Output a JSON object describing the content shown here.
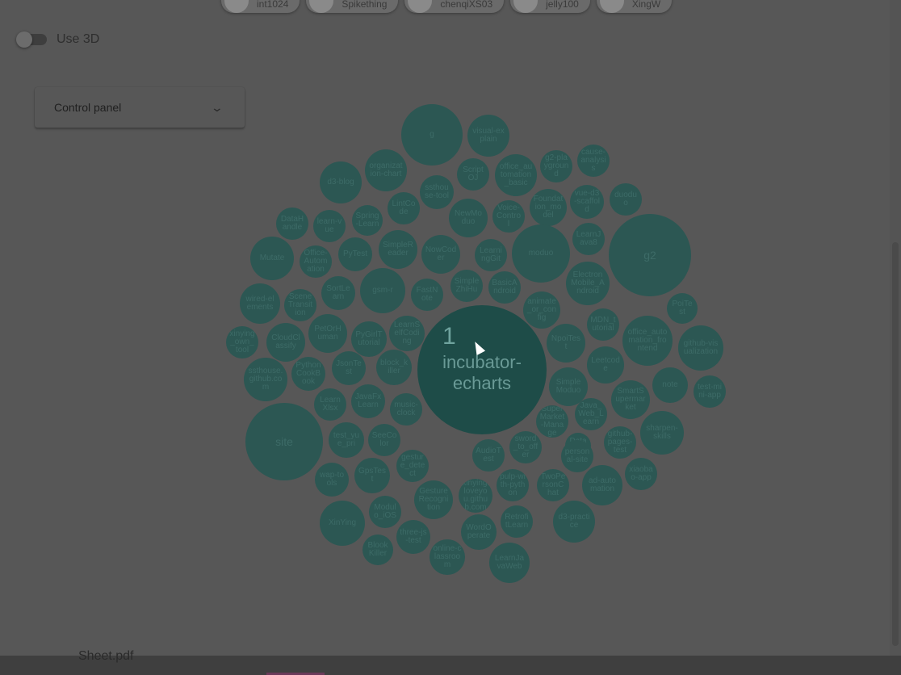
{
  "users": [
    {
      "name": "int1024"
    },
    {
      "name": "Spikething"
    },
    {
      "name": "chenqiXS03"
    },
    {
      "name": "jelly100"
    },
    {
      "name": "XingW"
    }
  ],
  "toggle3d": {
    "label": "Use 3D",
    "checked": false
  },
  "control_panel": {
    "title": "Control panel"
  },
  "highlight": {
    "rank": "1",
    "name": "incubator-echarts"
  },
  "bubbles": [
    {
      "label": "g"
    },
    {
      "label": "visual-explain"
    },
    {
      "label": "cause-analysis"
    },
    {
      "label": "g2-playground"
    },
    {
      "label": "office_automation_basic"
    },
    {
      "label": "ScriptOJ"
    },
    {
      "label": "organization-chart"
    },
    {
      "label": "d3-blog"
    },
    {
      "label": "ssthouse-tool"
    },
    {
      "label": "vue-d3-scaffold"
    },
    {
      "label": "duoduo"
    },
    {
      "label": "Foundation_model"
    },
    {
      "label": "LintCode"
    },
    {
      "label": "Spring-Learn"
    },
    {
      "label": "DataHandle"
    },
    {
      "label": "learn-vue"
    },
    {
      "label": "NewModuo"
    },
    {
      "label": "Voice-Control"
    },
    {
      "label": "g2"
    },
    {
      "label": "LearnJava8"
    },
    {
      "label": "Mutate"
    },
    {
      "label": "Office-Automation"
    },
    {
      "label": "PyTest"
    },
    {
      "label": "SimpleReader"
    },
    {
      "label": "NowCoder"
    },
    {
      "label": "LearningGit"
    },
    {
      "label": "moduo"
    },
    {
      "label": "ElectronMobile_Android"
    },
    {
      "label": "PoiTest"
    },
    {
      "label": "gsm-r"
    },
    {
      "label": "SortLearn"
    },
    {
      "label": "SimpleZhiHu"
    },
    {
      "label": "BasicAndroid"
    },
    {
      "label": "wired-elements"
    },
    {
      "label": "SceneTransition"
    },
    {
      "label": "FastNote"
    },
    {
      "label": "animate_or_config"
    },
    {
      "label": "MDN_tutorial"
    },
    {
      "label": "office_automation_frontend"
    },
    {
      "label": "incubator-echarts"
    },
    {
      "label": "PetOrHuman"
    },
    {
      "label": "LearnSelfCoding"
    },
    {
      "label": "xinying_own_tool"
    },
    {
      "label": "CloudClassify"
    },
    {
      "label": "PyGirlTutorial"
    },
    {
      "label": "NpoiTest"
    },
    {
      "label": "github-visualization"
    },
    {
      "label": "Leetcode"
    },
    {
      "label": "JsonTest"
    },
    {
      "label": "PythonCookBook"
    },
    {
      "label": "block_killer"
    },
    {
      "label": "note"
    },
    {
      "label": "ssthouse.github.com"
    },
    {
      "label": "SimpleModuo"
    },
    {
      "label": "test-mini-app"
    },
    {
      "label": "SmartSupermarket"
    },
    {
      "label": "JavaFxLearn"
    },
    {
      "label": "LearnXlsx"
    },
    {
      "label": "music-clock"
    },
    {
      "label": "Java_Web_Learn"
    },
    {
      "label": "SuperMarket-Manage"
    },
    {
      "label": "sharpen-skills"
    },
    {
      "label": "site"
    },
    {
      "label": "test_yue_pri"
    },
    {
      "label": "SeeColor"
    },
    {
      "label": "Data_Op"
    },
    {
      "label": "personal-site"
    },
    {
      "label": "github-pages-test"
    },
    {
      "label": "sword_to_offer"
    },
    {
      "label": "AudioTest"
    },
    {
      "label": "gesture_detect"
    },
    {
      "label": "xiaobao-app"
    },
    {
      "label": "wap-tools"
    },
    {
      "label": "GpsTest"
    },
    {
      "label": "ad-automation"
    },
    {
      "label": "pulp-with-python"
    },
    {
      "label": "TwoPersonChat"
    },
    {
      "label": "xinyingiloveyou.github.com"
    },
    {
      "label": "GestureRecognition"
    },
    {
      "label": "XinYing"
    },
    {
      "label": "Modulo_iOS"
    },
    {
      "label": "d3-practice"
    },
    {
      "label": "RetrofitLearn"
    },
    {
      "label": "WordOperate"
    },
    {
      "label": "three-js-test"
    },
    {
      "label": "BlookKiller"
    },
    {
      "label": "LearnJavaWeb"
    },
    {
      "label": "online-classroom"
    }
  ],
  "bottom": {
    "file": "Sheet.pdf"
  }
}
